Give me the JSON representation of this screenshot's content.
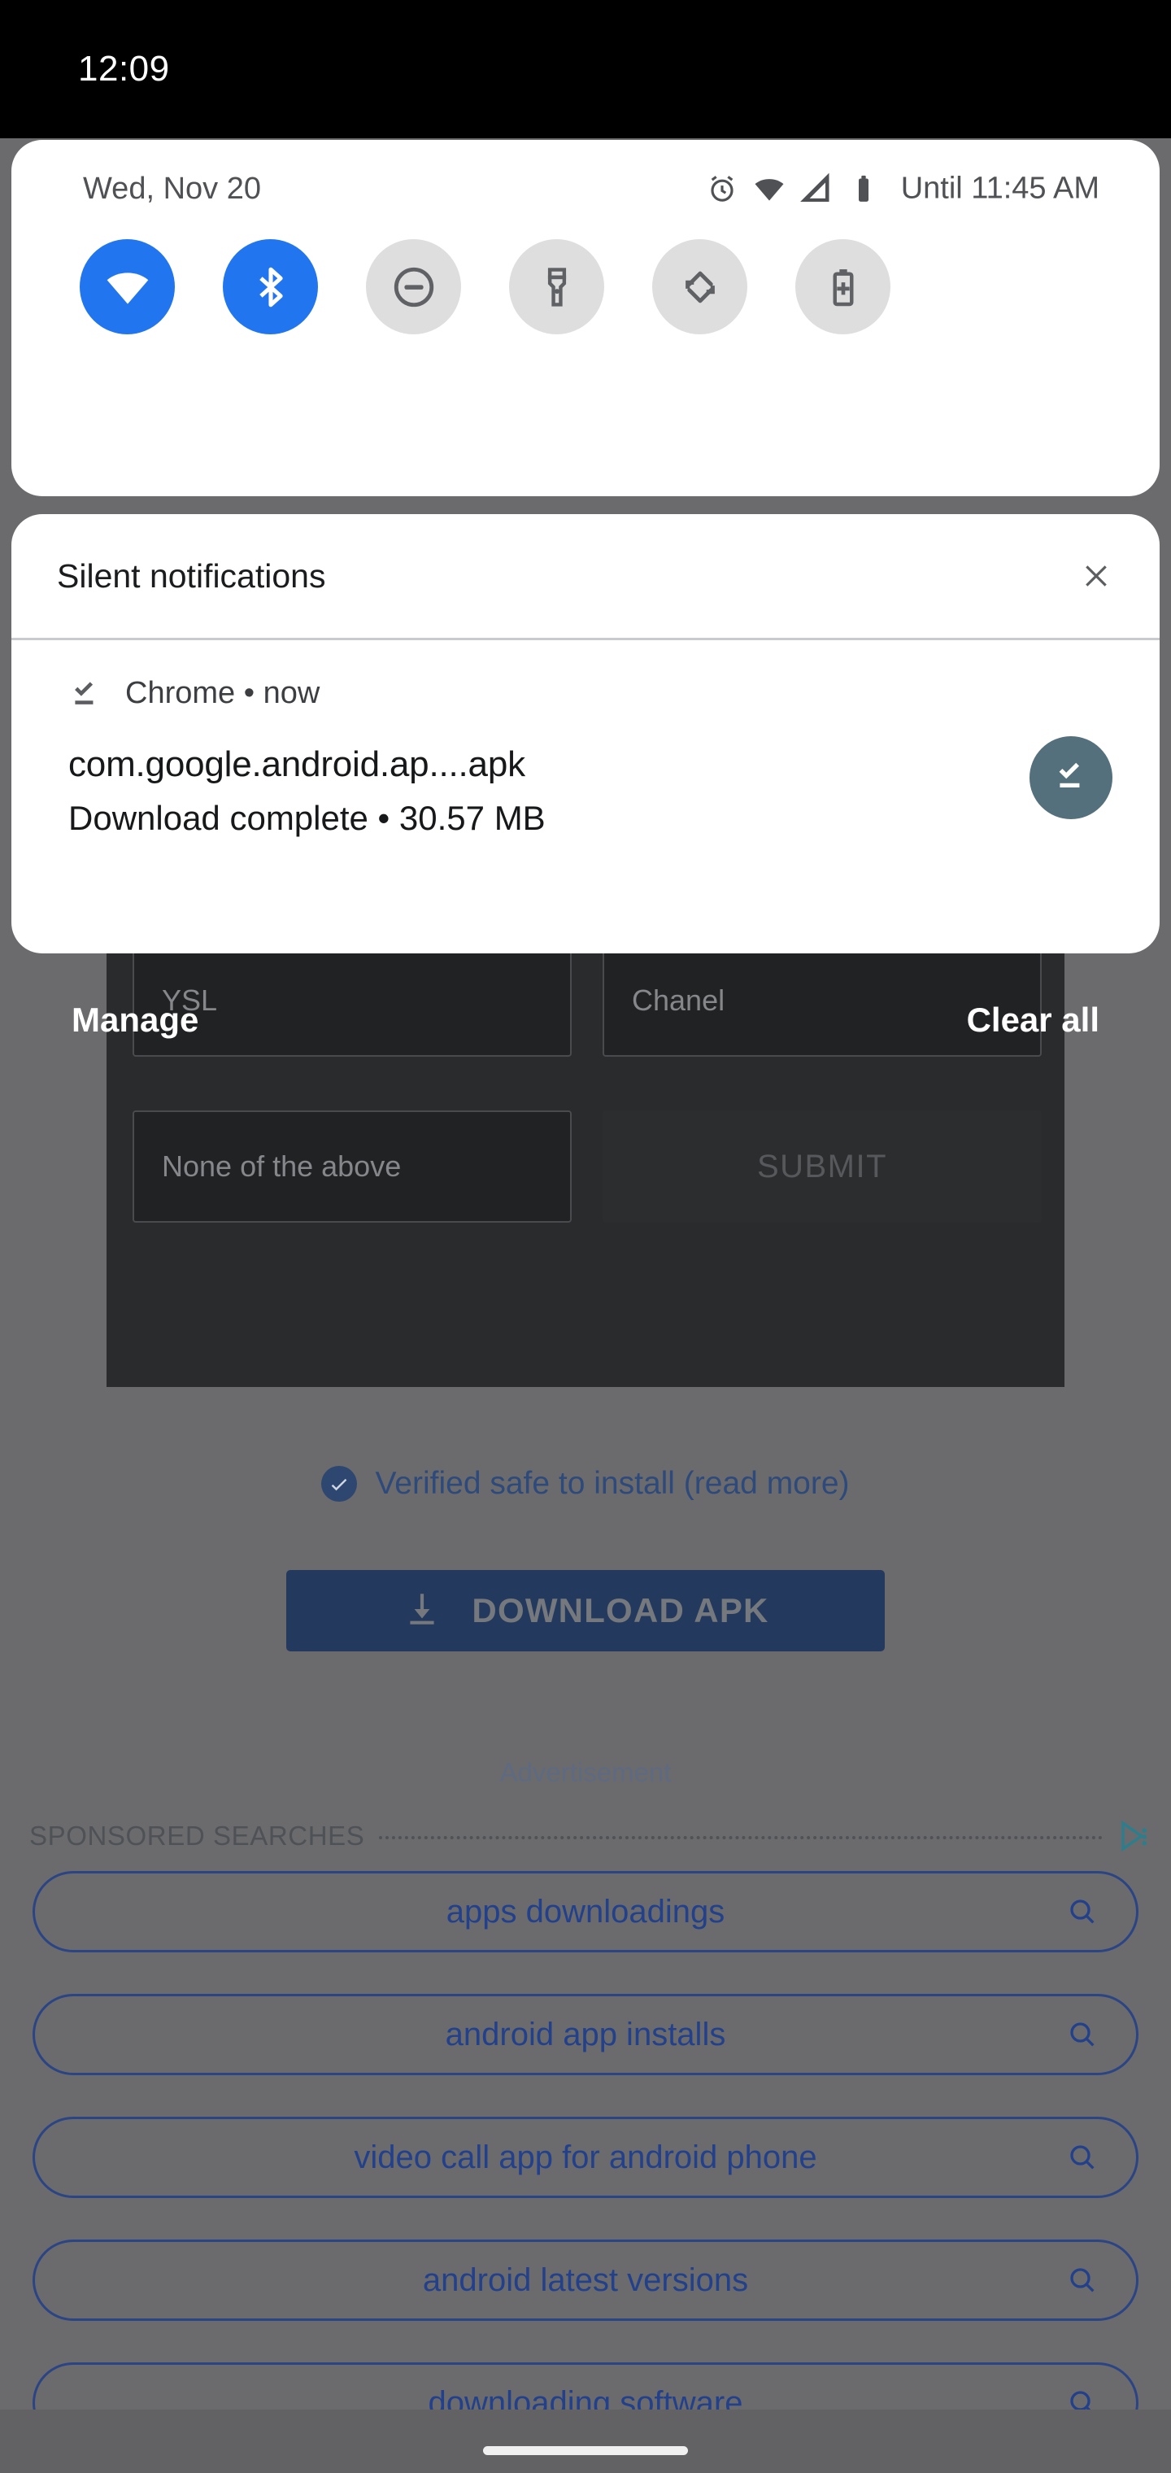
{
  "status_bar": {
    "clock": "12:09"
  },
  "quick_settings": {
    "date": "Wed, Nov 20",
    "dnd_until": "Until 11:45 AM",
    "status_icons": [
      "alarm-icon",
      "wifi-icon",
      "cellular-signal-icon",
      "battery-icon"
    ],
    "tiles": [
      {
        "name": "wifi",
        "icon": "wifi-icon",
        "state": "on"
      },
      {
        "name": "bluetooth",
        "icon": "bluetooth-icon",
        "state": "on"
      },
      {
        "name": "do-not-disturb",
        "icon": "do-not-disturb-icon",
        "state": "off"
      },
      {
        "name": "flashlight",
        "icon": "flashlight-icon",
        "state": "off"
      },
      {
        "name": "auto-rotate",
        "icon": "auto-rotate-icon",
        "state": "off"
      },
      {
        "name": "battery-saver",
        "icon": "battery-saver-icon",
        "state": "off"
      }
    ],
    "colors": {
      "tile_on": "#2176ef",
      "tile_off": "#dededf"
    }
  },
  "notification_shade": {
    "section_header": "Silent notifications",
    "close_icon": "close-icon",
    "notification": {
      "app_icon": "download-done-icon",
      "app_line": "Chrome • now",
      "title": "com.google.android.ap....apk",
      "subtitle": "Download complete • 30.57 MB",
      "action_icon": "download-done-icon",
      "action_color": "#54707d"
    },
    "manage_label": "Manage",
    "clear_all_label": "Clear all"
  },
  "background_app": {
    "quiz": {
      "options": [
        "YSL",
        "Chanel",
        "None of the above"
      ],
      "submit_label": "SUBMIT"
    },
    "verified_text": "Verified safe to install (read more)",
    "download_button_label": "DOWNLOAD APK",
    "advertisement_label": "Advertisement",
    "sponsored_title": "SPONSORED SEARCHES",
    "sponsored_searches": [
      "apps downloadings",
      "android app installs",
      "video call app for android phone",
      "android latest versions",
      "downloading software"
    ],
    "colors": {
      "accent_blue": "#23408a",
      "button_blue": "#23395e"
    }
  }
}
